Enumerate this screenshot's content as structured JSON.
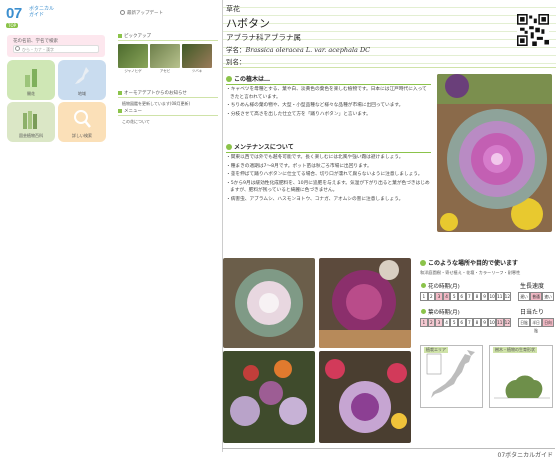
{
  "logo": {
    "num": "07",
    "line1": "ボタニカル",
    "line2": "ガイド",
    "badge": "TOP"
  },
  "search": {
    "label": "花の名前、学名で検索",
    "placeholder": "ひら・カナ・漢字"
  },
  "tiles": [
    {
      "label": "開花",
      "color": "#cfe7b5"
    },
    {
      "label": "地域",
      "color": "#c9dcef"
    },
    {
      "label": "園芸植物百科",
      "color": "#dbe7c6"
    },
    {
      "label": "詳しい検索",
      "color": "#fbe0b8"
    }
  ],
  "update": {
    "label": "最新アップデート"
  },
  "pickup": {
    "heading": "ピックアップ",
    "items": [
      "ジャノヒゲ",
      "アセビ",
      "ツバキ"
    ]
  },
  "news": {
    "heading": "オーモアデプトからのお知らせ",
    "items": [
      "植物図鑑を更新しています(08月更新)"
    ]
  },
  "menu": {
    "heading": "メニュー",
    "items": [
      "この花について"
    ]
  },
  "plant": {
    "category": "草花",
    "name": "ハボタン",
    "family": "アブラナ科アブラナ属",
    "sci_label": "学名：",
    "sci_name": "Brassica oleracea L. var. acephala DC",
    "alias_label": "別名："
  },
  "about": {
    "heading": "この植木は…",
    "bullets": [
      "キャベツを母種とする、葉や白、淡黄色の葉色を楽しむ植物です。日本には江戸時代に入ってきたと言われています。",
      "ちりめん様の葉の物や、大型・小型品種など様々な品種が市場に出回っています。",
      "分枝させて高さを出した仕立て方を「踊りハボタン」と言います。"
    ]
  },
  "maintenance": {
    "heading": "メンテナンスについて",
    "bullets": [
      "関東以西では外でも越冬可能です。長く楽しむには北風や強い霜は避けましょう。",
      "種まきの適期は7〜8月です。ポット苗は秋ごろ市場に出回ります。",
      "茎を伸ばて踊りハボタンに仕立てる場合、切り口が濡れて腐らないように注意しましょう。",
      "5から9月は緩効性化成肥料を、10月に追肥を与えます。気温が下がり出ると葉が色づきはじめますが、肥料が残っていると綺麗に色づきません。",
      "病害虫、アブラムシ、ハスモンヨトウ、コナガ、アオムシの害に注意しましょう。"
    ]
  },
  "uses": {
    "heading": "このような場所や目的で使います",
    "tags": "和洋庭園樹・寄せ植え・花壇・カラーリーフ・耐寒性"
  },
  "flower_season": {
    "label": "花の時期(月)",
    "months": [
      "1",
      "2",
      "3",
      "4",
      "5",
      "6",
      "7",
      "8",
      "9",
      "10",
      "11",
      "12"
    ],
    "active": [
      3,
      4
    ]
  },
  "leaf_season": {
    "label": "葉の時期(月)",
    "months": [
      "1",
      "2",
      "3",
      "4",
      "5",
      "6",
      "7",
      "8",
      "9",
      "10",
      "11",
      "12"
    ],
    "active": [
      1,
      2,
      3,
      11,
      12
    ]
  },
  "growth": {
    "label": "生長速度",
    "levels": [
      "遅い",
      "普通",
      "速い"
    ],
    "active": 1
  },
  "sun": {
    "label": "日当たり",
    "levels": [
      "日陰",
      "半日陰",
      "日向"
    ],
    "active": 2
  },
  "maps": {
    "area_label": "植栽エリア",
    "shape_label": "樹木・植物の生育形状"
  },
  "footer": "07ボタニカルガイド"
}
